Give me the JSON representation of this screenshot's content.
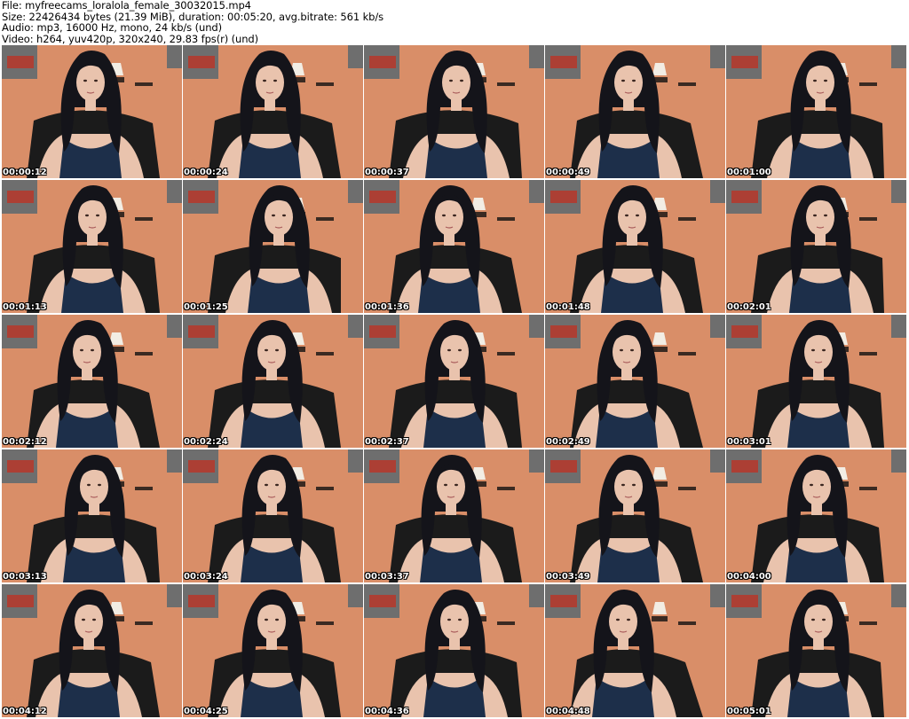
{
  "info": {
    "file": "File: myfreecams_loralola_female_30032015.mp4",
    "size": "Size: 22426434 bytes (21.39 MiB), duration: 00:05:20, avg.bitrate: 561 kb/s",
    "audio": "Audio: mp3, 16000 Hz, mono, 24 kb/s (und)",
    "video": "Video: h264, yuv420p, 320x240, 29.83 fps(r) (und)"
  },
  "colors": {
    "wall": "#d98e68",
    "hair": "#14141a",
    "skin": "#e9c3ad",
    "top": "#1d2f4a",
    "chair": "#1b1b1b",
    "poster": "#6e6e6e",
    "poster_red": "#b23a2e",
    "lamp": "#f2ede4"
  },
  "thumbnails": [
    {
      "time": "00:00:12",
      "icon": "video-frame"
    },
    {
      "time": "00:00:24",
      "icon": "video-frame"
    },
    {
      "time": "00:00:37",
      "icon": "video-frame"
    },
    {
      "time": "00:00:49",
      "icon": "video-frame"
    },
    {
      "time": "00:01:00",
      "icon": "video-frame"
    },
    {
      "time": "00:01:13",
      "icon": "video-frame"
    },
    {
      "time": "00:01:25",
      "icon": "video-frame"
    },
    {
      "time": "00:01:36",
      "icon": "video-frame"
    },
    {
      "time": "00:01:48",
      "icon": "video-frame"
    },
    {
      "time": "00:02:01",
      "icon": "video-frame"
    },
    {
      "time": "00:02:12",
      "icon": "video-frame"
    },
    {
      "time": "00:02:24",
      "icon": "video-frame"
    },
    {
      "time": "00:02:37",
      "icon": "video-frame"
    },
    {
      "time": "00:02:49",
      "icon": "video-frame"
    },
    {
      "time": "00:03:01",
      "icon": "video-frame"
    },
    {
      "time": "00:03:13",
      "icon": "video-frame"
    },
    {
      "time": "00:03:24",
      "icon": "video-frame"
    },
    {
      "time": "00:03:37",
      "icon": "video-frame"
    },
    {
      "time": "00:03:49",
      "icon": "video-frame"
    },
    {
      "time": "00:04:00",
      "icon": "video-frame"
    },
    {
      "time": "00:04:12",
      "icon": "video-frame"
    },
    {
      "time": "00:04:25",
      "icon": "video-frame"
    },
    {
      "time": "00:04:36",
      "icon": "video-frame"
    },
    {
      "time": "00:04:48",
      "icon": "video-frame"
    },
    {
      "time": "00:05:01",
      "icon": "video-frame"
    }
  ]
}
